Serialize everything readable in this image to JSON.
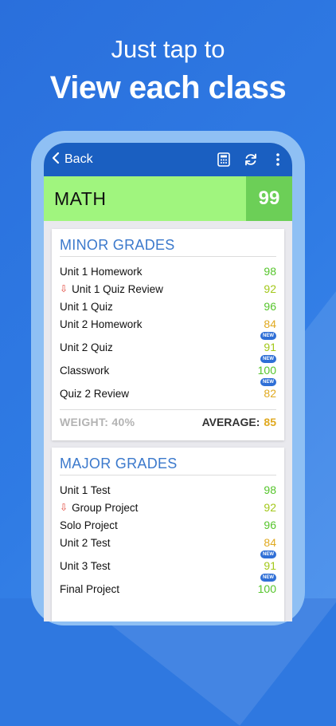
{
  "promo": {
    "line1": "Just tap to",
    "line2": "View each class"
  },
  "appbar": {
    "back_label": "Back"
  },
  "icons": {
    "back": "chevron-left-icon",
    "calc": "calculator-icon",
    "refresh": "refresh-icon",
    "menu": "more-vertical-icon"
  },
  "class": {
    "name": "MATH",
    "grade": "99"
  },
  "colors": {
    "green": "#56c52c",
    "lime": "#a3c81a",
    "amber": "#e0a91f",
    "yellow": "#c5c21a",
    "header_bg": "#a0f57e",
    "grade_bg": "#6ccf57",
    "appbar": "#1a5fc1"
  },
  "minor": {
    "title": "MINOR GRADES",
    "items": [
      {
        "name": "Unit 1 Homework",
        "value": "98",
        "color": "#56c52c",
        "down": false,
        "new": false
      },
      {
        "name": "Unit 1 Quiz Review",
        "value": "92",
        "color": "#a3c81a",
        "down": true,
        "new": false
      },
      {
        "name": "Unit 1 Quiz",
        "value": "96",
        "color": "#56c52c",
        "down": false,
        "new": false
      },
      {
        "name": "Unit 2 Homework",
        "value": "84",
        "color": "#e0a91f",
        "down": false,
        "new": false
      },
      {
        "name": "Unit 2 Quiz",
        "value": "91",
        "color": "#a3c81a",
        "down": false,
        "new": true
      },
      {
        "name": "Classwork",
        "value": "100",
        "color": "#56c52c",
        "down": false,
        "new": true
      },
      {
        "name": "Quiz 2 Review",
        "value": "82",
        "color": "#e0a91f",
        "down": false,
        "new": true
      }
    ],
    "weight": "WEIGHT: 40%",
    "average_label": "AVERAGE:",
    "average_value": "85",
    "average_color": "#e0a91f"
  },
  "major": {
    "title": "MAJOR GRADES",
    "items": [
      {
        "name": "Unit 1 Test",
        "value": "98",
        "color": "#56c52c",
        "down": false,
        "new": false
      },
      {
        "name": "Group Project",
        "value": "92",
        "color": "#a3c81a",
        "down": true,
        "new": false
      },
      {
        "name": "Solo Project",
        "value": "96",
        "color": "#56c52c",
        "down": false,
        "new": false
      },
      {
        "name": "Unit 2 Test",
        "value": "84",
        "color": "#e0a91f",
        "down": false,
        "new": false
      },
      {
        "name": "Unit 3 Test",
        "value": "91",
        "color": "#a3c81a",
        "down": false,
        "new": true
      },
      {
        "name": "Final Project",
        "value": "100",
        "color": "#56c52c",
        "down": false,
        "new": true
      }
    ]
  },
  "badge_text": "NEW",
  "down_glyph": "⇩"
}
